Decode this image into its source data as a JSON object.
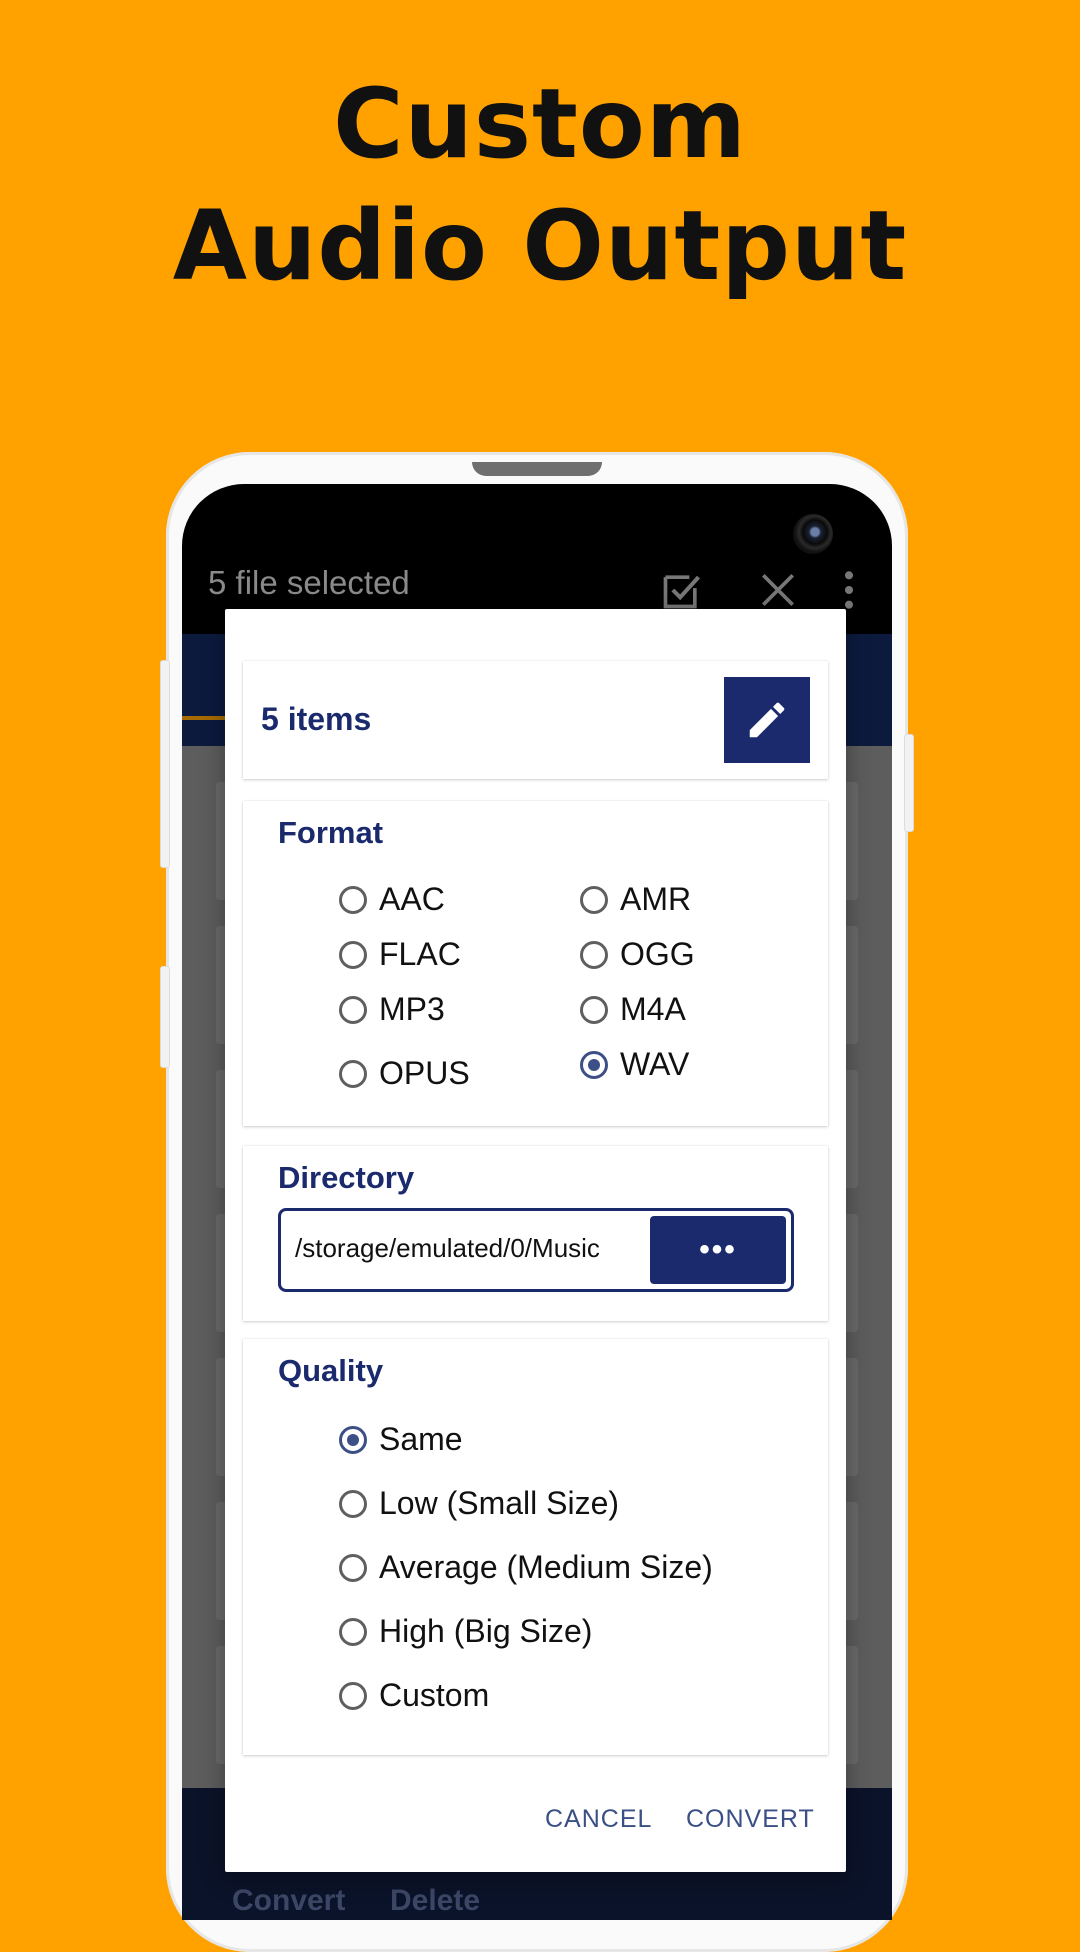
{
  "promo": {
    "line1": "Custom",
    "line2": "Audio Output"
  },
  "appbar": {
    "title": "5 file selected",
    "icons": [
      "select-all-icon",
      "close-icon",
      "more-vert-icon"
    ]
  },
  "bottom_nav": {
    "convert": "Convert",
    "delete": "Delete"
  },
  "dialog": {
    "items_title": "5 items",
    "format": {
      "title": "Format",
      "options": [
        "AAC",
        "AMR",
        "FLAC",
        "OGG",
        "MP3",
        "M4A",
        "OPUS",
        "WAV"
      ],
      "selected": "WAV"
    },
    "directory": {
      "title": "Directory",
      "value": "/storage/emulated/0/Music",
      "browse_label": "•••"
    },
    "quality": {
      "title": "Quality",
      "options": [
        "Same",
        "Low (Small Size)",
        "Average (Medium Size)",
        "High (Big Size)",
        "Custom"
      ],
      "selected": "Same"
    },
    "actions": {
      "cancel": "CANCEL",
      "convert": "CONVERT"
    }
  },
  "colors": {
    "background": "#FFA200",
    "primary": "#1A2A6C",
    "accent": "#3C4F86"
  }
}
